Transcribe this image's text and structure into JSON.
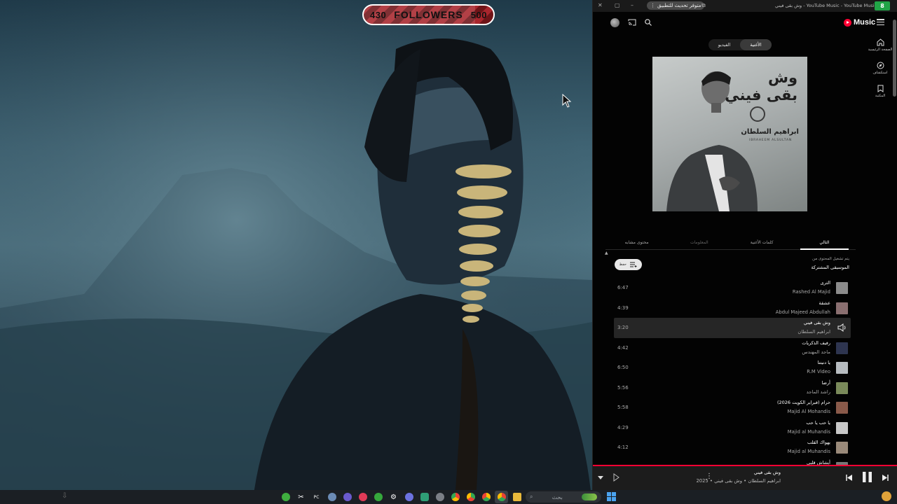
{
  "overlay": {
    "followers_current": "430",
    "followers_label": "FOLLOWERS",
    "followers_goal": "500",
    "followers_progress": 0.86
  },
  "browser": {
    "update_button": "متوفر تحديث للتطبيق",
    "tab_title": "وش بقى فيني - YouTube Music - YouTube Music",
    "extension_badge": "8"
  },
  "ytmusic": {
    "logo_text": "Music",
    "side_nav": [
      {
        "label": "الصفحة الرئيسية",
        "icon": "home-icon"
      },
      {
        "label": "استكشاف",
        "icon": "explore-icon"
      },
      {
        "label": "المكتبة",
        "icon": "library-icon"
      }
    ],
    "toggle": {
      "song": "الأغنية",
      "video": "الفيديو"
    },
    "album_art": {
      "title_line1": "وش",
      "title_line2": "بقى فيني",
      "artist_ar": "ابراهيم السلطان",
      "artist_en": "IBRAHEEM ALSULTAN"
    },
    "tabs": [
      "التالي",
      "كلمات الأغنية",
      "المعلومات",
      "محتوى مشابه"
    ],
    "playing_from_label": "يتم تشغيل المحتوى من",
    "playing_from_source": "الموسيقى المشتركة",
    "chip_label": "حفظ",
    "queue": [
      {
        "title": "الثرى",
        "artist": "Rashed Al Majid",
        "duration": "6:47",
        "thumb": "#8c8c8c",
        "current": false
      },
      {
        "title": "عشقة",
        "artist": "Abdul Majeed Abdullah",
        "duration": "4:39",
        "thumb": "#8a6f70",
        "current": false
      },
      {
        "title": "وش بقى فيني",
        "artist": "ابراهيم السلطان",
        "duration": "3:20",
        "thumb": "#aaaaaa",
        "current": true
      },
      {
        "title": "رفيف الذكريات",
        "artist": "ماجد المهندس",
        "duration": "4:42",
        "thumb": "#2e3550",
        "current": false
      },
      {
        "title": "يا دنيتنا",
        "artist": "R.M Video",
        "duration": "6:50",
        "thumb": "#b7bcc0",
        "current": false
      },
      {
        "title": "أرضا",
        "artist": "راشد الماجد",
        "duration": "5:56",
        "thumb": "#7a8a5a",
        "current": false
      },
      {
        "title": "حرام (فبراير الكويت 2026)",
        "artist": "Majid Al Mohandis",
        "duration": "5:58",
        "thumb": "#8a5a4a",
        "current": false
      },
      {
        "title": "يا حب يا حب",
        "artist": "Majid al Muhandis",
        "duration": "4:29",
        "thumb": "#c8c8c8",
        "current": false
      },
      {
        "title": "يهواك القلب",
        "artist": "Majid al Muhandis",
        "duration": "4:12",
        "thumb": "#9a8a7a",
        "current": false
      },
      {
        "title": "أبشاش قلبي",
        "artist": "",
        "duration": "",
        "thumb": "#777777",
        "current": false
      }
    ],
    "player": {
      "title": "وش بقى فيني",
      "subtitle": "ابراهيم السلطان • وش بقى فيني • 2025"
    }
  },
  "taskbar": {
    "search_placeholder": "بحث"
  },
  "colors": {
    "accent_red": "#ff0033",
    "progress_green": "#21a447"
  }
}
